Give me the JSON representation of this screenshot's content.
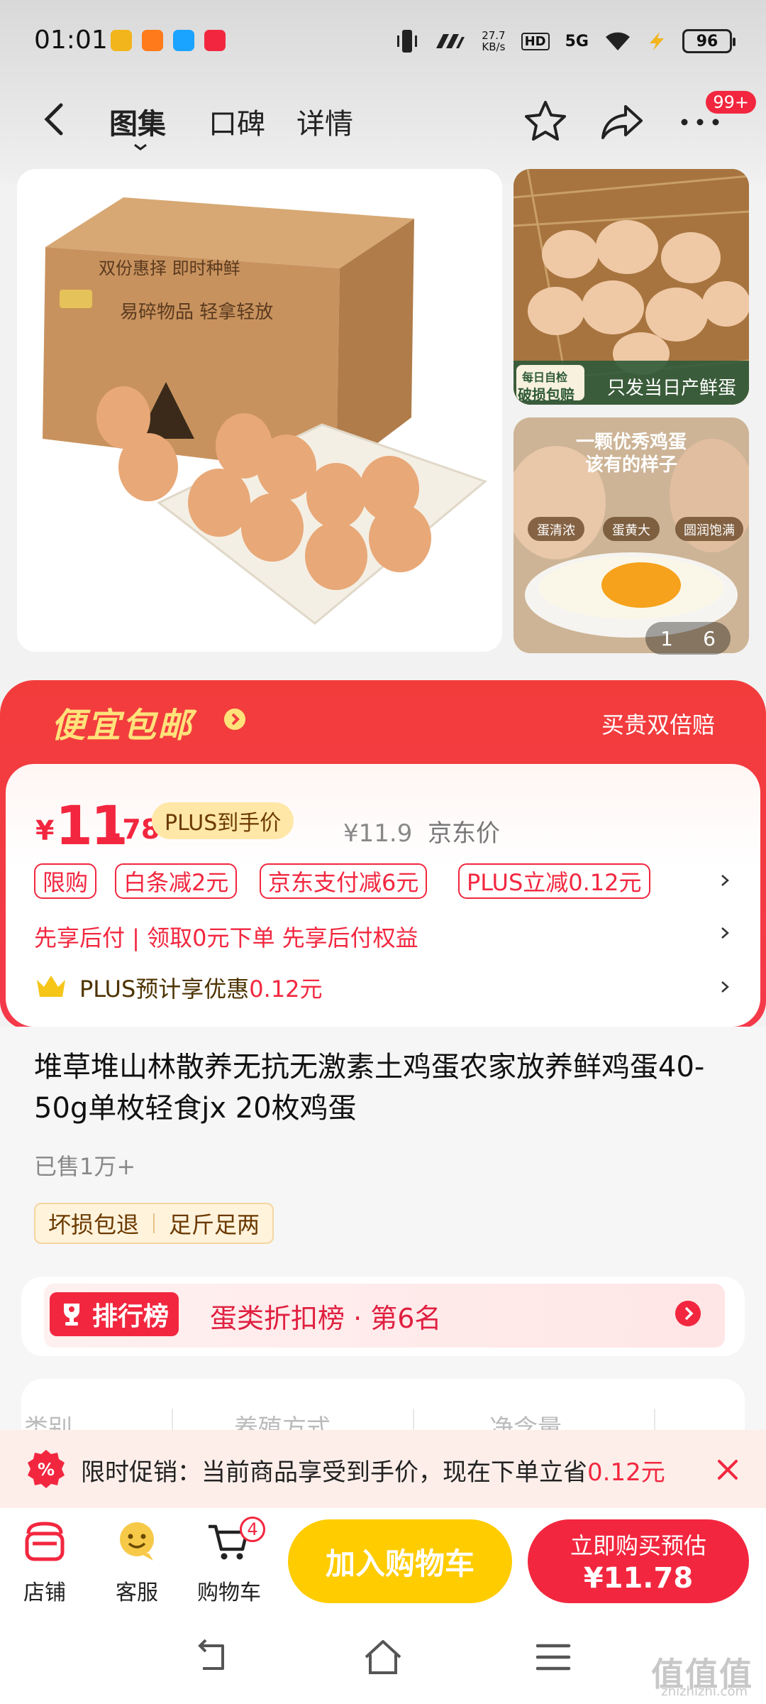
{
  "status_bar": {
    "time": "01:01",
    "net_speed_value": "27.7",
    "net_speed_unit": "KB/s",
    "hd": "HD",
    "signal": "5G",
    "battery": "96"
  },
  "header": {
    "tabs": [
      "图集",
      "口碑",
      "详情"
    ],
    "active_tab": "图集",
    "more_badge": "99+"
  },
  "gallery": {
    "box_text_1": "易碎物品  轻拿轻放",
    "box_text_2": "双份惠择  即时种鲜",
    "thumb1_badge_top": "每日自检",
    "thumb1_badge_bottom": "破损包赔",
    "thumb1_caption": "只发当日产鲜蛋",
    "thumb2_title_1": "一颗优秀鸡蛋",
    "thumb2_title_2": "该有的样子",
    "thumb2_tags": [
      "蛋清浓",
      "蛋黄大",
      "圆润饱满"
    ],
    "counter_current": "1",
    "counter_total": "6"
  },
  "promo_banner": {
    "title": "便宜包邮",
    "right_text": "买贵双倍赔"
  },
  "price": {
    "currency": "¥",
    "integer": "11",
    "decimal": ".78",
    "plus_tag": "PLUS到手价",
    "jd_price": "¥11.9",
    "jd_label": "京东价"
  },
  "coupons": [
    "限购",
    "白条减2元",
    "京东支付减6元",
    "PLUS立减0.12元"
  ],
  "pay_later": "先享后付 | 领取0元下单 先享后付权益",
  "plus_benefit": {
    "text": "PLUS预计享优惠",
    "amount": "0.12元"
  },
  "product": {
    "title": "堆草堆山林散养无抗无激素土鸡蛋农家放养鲜鸡蛋40-50g单枚轻食jx 20枚鸡蛋",
    "sold": "已售1万+",
    "guarantees": [
      "坏损包退",
      "足斤足两"
    ]
  },
  "ranking": {
    "tag": "排行榜",
    "text": "蛋类折扣榜 · 第6名"
  },
  "specs": [
    "类别",
    "养殖方式",
    "净含量"
  ],
  "limited_promo": {
    "text": "限时促销：当前商品享受到手价，现在下单立省",
    "amount": "0.12元"
  },
  "actions": {
    "shop": "店铺",
    "service": "客服",
    "cart": "购物车",
    "cart_count": "4",
    "add_to_cart": "加入购物车",
    "buy_now": "立即购买预估",
    "buy_price": "¥11.78"
  },
  "watermark": {
    "main": "值值值",
    "sub": "zhizhizhi.com"
  },
  "colors": {
    "brand_red": "#f2273f",
    "promo_yellow": "#ffe27a",
    "cart_yellow": "#ffcc00"
  }
}
